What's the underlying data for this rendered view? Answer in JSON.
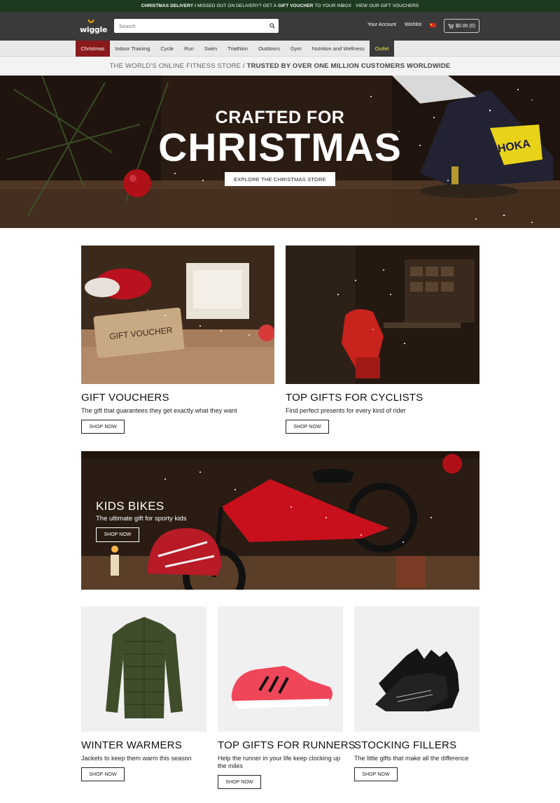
{
  "promo": {
    "part1": "CHRISTMAS DELIVERY",
    "sep": "/",
    "part2": "MISSED OUT ON DELIVERY? GET A",
    "part3": "GIFT VOUCHER",
    "part4": "TO YOUR INBOX",
    "link": "VIEW OUR GIFT VOUCHERS"
  },
  "header": {
    "logo_text": "wiggle",
    "search_placeholder": "Search",
    "account": "Your Account",
    "wishlist": "Wishlist",
    "cart": "$0.00 (0)"
  },
  "nav": {
    "items": [
      "Christmas",
      "Indoor Training",
      "Cycle",
      "Run",
      "Swim",
      "Triathlon",
      "Outdoors",
      "Gym",
      "Nutrition and Wellness",
      "Outlet"
    ]
  },
  "trust": {
    "left": "THE WORLD'S ONLINE FITNESS STORE /",
    "right": "TRUSTED BY OVER ONE MILLION CUSTOMERS WORLDWIDE"
  },
  "hero": {
    "line1": "CRAFTED FOR",
    "line2": "CHRISTMAS",
    "button": "EXPLORE THE CHRISTMAS STORE",
    "shoe_brand": "HOKA"
  },
  "cards": [
    {
      "title": "GIFT VOUCHERS",
      "subtitle": "The gift that guarantees they get exactly what they want",
      "button": "SHOP NOW",
      "image_text": "GIFT VOUCHER"
    },
    {
      "title": "TOP GIFTS FOR CYCLISTS",
      "subtitle": "Find perfect presents for every kind of rider",
      "button": "SHOP NOW"
    }
  ],
  "kids": {
    "title": "KIDS BIKES",
    "subtitle": "The ultimate gift for sporty kids",
    "button": "SHOP NOW"
  },
  "products": [
    {
      "title": "WINTER WARMERS",
      "subtitle": "Jackets to keep them warm this season",
      "button": "SHOP NOW"
    },
    {
      "title": "TOP GIFTS FOR RUNNERS",
      "subtitle": "Help the runner in your life keep clocking up the miles",
      "button": "SHOP NOW"
    },
    {
      "title": "STOCKING FILLERS",
      "subtitle": "The little gifts that make all the difference",
      "button": "SHOP NOW"
    }
  ],
  "colors": {
    "promo_bg": "#1d3a20",
    "header_bg": "#3a3a3a",
    "christmas_tab": "#8b1a1a",
    "outlet_text": "#e6e34a"
  }
}
